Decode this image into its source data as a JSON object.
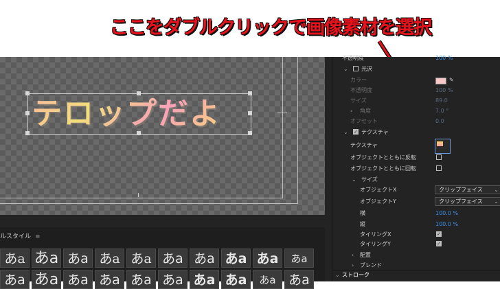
{
  "annotation": {
    "text": "ここをダブルクリックで画像素材を選択",
    "color": "#e8121c"
  },
  "monitor": {
    "telop_text": "テロップだよ"
  },
  "styles_panel": {
    "title": "ルスタイル",
    "menu_icon": "hamburger-icon",
    "row1": [
      "あa",
      "あa",
      "あa",
      "あa",
      "あa",
      "あa",
      "あa",
      "あa",
      "あa",
      "あa"
    ],
    "row2": [
      "あa",
      "あa",
      "あa",
      "あa",
      "あa",
      "あa",
      "あa",
      "あa",
      "あa",
      "あa"
    ]
  },
  "effect_controls": {
    "opacity": {
      "label": "不透明度",
      "value": "100 %"
    },
    "gloss": {
      "label": "光沢",
      "checked": false
    },
    "gloss_color_label": "カラー",
    "gloss_opacity": {
      "label": "不透明度",
      "value": "100 %"
    },
    "gloss_size": {
      "label": "サイズ",
      "value": "89.0"
    },
    "gloss_angle": {
      "label": "角度",
      "value": "7.0 °"
    },
    "gloss_offset": {
      "label": "オフセット",
      "value": "0.0"
    },
    "texture": {
      "label": "テクスチャ",
      "checked": true
    },
    "texture_field_label": "テクスチャ",
    "flip_with_object": {
      "label": "オブジェクトとともに反転",
      "checked": false
    },
    "rotate_with_object": {
      "label": "オブジェクトとともに回転",
      "checked": false
    },
    "size_section": "サイズ",
    "object_x": {
      "label": "オブジェクトX",
      "value": "クリップフェイス"
    },
    "object_y": {
      "label": "オブジェクトY",
      "value": "クリップフェイス"
    },
    "width": {
      "label": "横",
      "value": "100.0 %"
    },
    "height": {
      "label": "縦",
      "value": "100.0 %"
    },
    "tiling_x": {
      "label": "タイリングX",
      "checked": true
    },
    "tiling_y": {
      "label": "タイリングY",
      "checked": true
    },
    "placement": "配置",
    "blend": "ブレンド",
    "stroke": "ストローク"
  }
}
